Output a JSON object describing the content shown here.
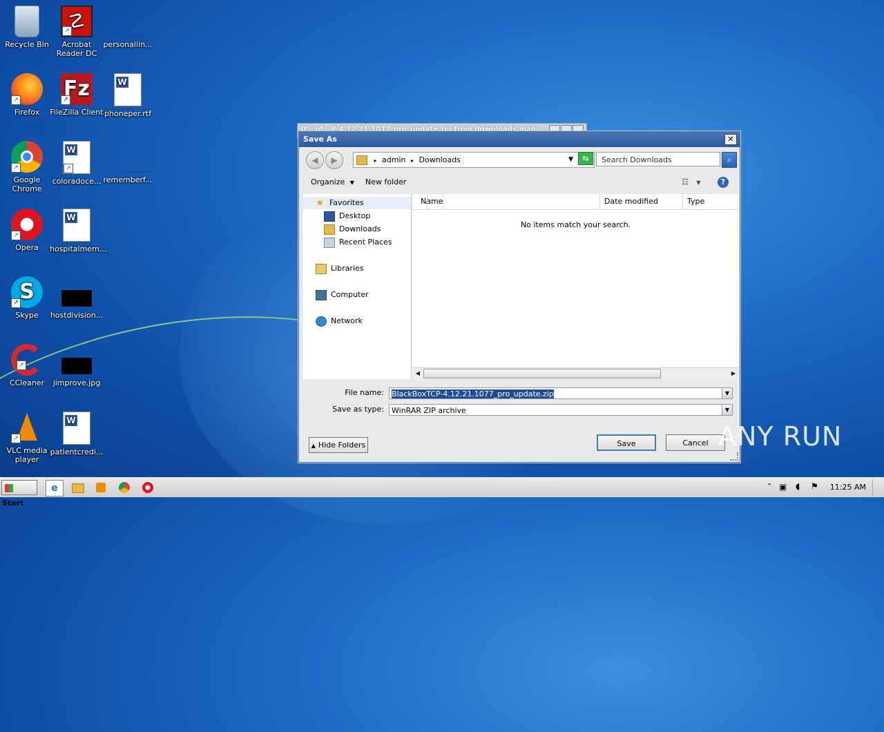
{
  "desktop": {
    "icons": [
      {
        "label": "Recycle Bin"
      },
      {
        "label": "Acrobat Reader DC"
      },
      {
        "label": "personallin..."
      },
      {
        "label": "Firefox"
      },
      {
        "label": "FileZilla Client"
      },
      {
        "label": "phoneper.rtf"
      },
      {
        "label": "Google Chrome"
      },
      {
        "label": "coloradoce..."
      },
      {
        "label": "rememberf..."
      },
      {
        "label": "Opera"
      },
      {
        "label": "hospitalmem..."
      },
      {
        "label": "Skype"
      },
      {
        "label": "hostdivision..."
      },
      {
        "label": "CCleaner"
      },
      {
        "label": "jimprove.jpg"
      },
      {
        "label": "VLC media player"
      },
      {
        "label": "patientcredi..."
      }
    ]
  },
  "background_window": {
    "title": "0% of _ P-4.12.21.1077_pro_update.zip from downloads.mani"
  },
  "dialog": {
    "title": "Save As",
    "close_glyph": "✕",
    "address": {
      "path": [
        "admin",
        "Downloads"
      ],
      "separator": "▸"
    },
    "search_placeholder": "Search Downloads",
    "toolbar": {
      "organize": "Organize",
      "new_folder": "New folder"
    },
    "nav": {
      "favorites": "Favorites",
      "desktop": "Desktop",
      "downloads": "Downloads",
      "recent_places": "Recent Places",
      "libraries": "Libraries",
      "computer": "Computer",
      "network": "Network"
    },
    "columns": {
      "name": "Name",
      "date_modified": "Date modified",
      "type": "Type"
    },
    "empty_message": "No items match your search.",
    "file_name_label": "File name:",
    "file_name_value": "BlackBoxTCP-4.12.21.1077_pro_update.zip",
    "save_as_type_label": "Save as type:",
    "save_as_type_value": "WinRAR ZIP archive",
    "hide_folders": "Hide Folders",
    "save": "Save",
    "cancel": "Cancel"
  },
  "watermark": "ANY RUN",
  "taskbar": {
    "start": "Start",
    "clock": "11:25 AM"
  }
}
